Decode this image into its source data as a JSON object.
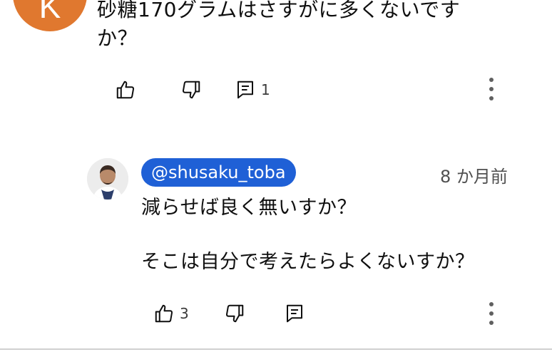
{
  "top_comment": {
    "avatar_initial": "K",
    "avatar_color": "#e0782f",
    "text": "砂糖170グラムはさすがに多くないですか？",
    "reply_count": "1"
  },
  "reply": {
    "handle": "@shusaku_toba",
    "handle_badge_color": "#1f60d6",
    "time": "8 か月前",
    "line1": "減らせば良く無いすか？",
    "line2": "そこは自分で考えたらよくないすか？",
    "like_count": "3"
  },
  "icons": {
    "like": "thumb-up-icon",
    "dislike": "thumb-down-icon",
    "reply": "reply-icon",
    "more": "more-vert-icon"
  }
}
